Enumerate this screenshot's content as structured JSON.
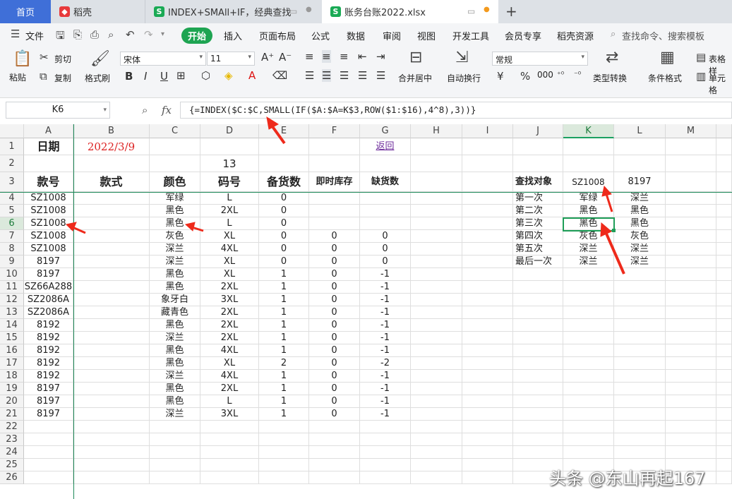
{
  "tabs": {
    "home": "首页",
    "t1": "稻壳",
    "t2": "INDEX+SMAll+IF，经典查找",
    "t3": "账务台账2022.xlsx",
    "new": "+"
  },
  "menubar": {
    "file": "文件",
    "items": [
      "开始",
      "插入",
      "页面布局",
      "公式",
      "数据",
      "审阅",
      "视图",
      "开发工具",
      "会员专享",
      "稻壳资源"
    ],
    "search": "查找命令、搜索模板"
  },
  "toolbar": {
    "paste": "粘贴",
    "cut": "剪切",
    "copy": "复制",
    "format_painter": "格式刷",
    "font_name": "宋体",
    "font_size": "11",
    "merge": "合并居中",
    "wrap": "自动换行",
    "number_format": "常规",
    "type_convert": "类型转换",
    "cond_format": "条件格式",
    "table_style": "表格样",
    "cell_style": "单元格",
    "bold": "B",
    "italic": "I",
    "underline": "U",
    "currency": "¥",
    "percent": "%",
    "thousands": "000"
  },
  "formula_bar": {
    "name_box": "K6",
    "fx": "fx",
    "formula": "{=INDEX($C:$C,SMALL(IF($A:$A=K$3,ROW($1:$16),4^8),3))}"
  },
  "columns": [
    "A",
    "B",
    "C",
    "D",
    "E",
    "F",
    "G",
    "H",
    "I",
    "J",
    "K",
    "L",
    "M"
  ],
  "rows": [
    "1",
    "2",
    "3",
    "4",
    "5",
    "6",
    "7",
    "8",
    "9",
    "10",
    "11",
    "12",
    "13",
    "14",
    "15",
    "16",
    "17",
    "18",
    "19",
    "20",
    "21",
    "22",
    "23",
    "24",
    "25",
    "26"
  ],
  "sheet": {
    "r1": {
      "A": "日期",
      "B": "2022/3/9",
      "G": "返回"
    },
    "r2": {
      "D": "13"
    },
    "r3": {
      "A": "款号",
      "B": "款式",
      "C": "颜色",
      "D": "码号",
      "E": "备货数",
      "F": "即时库存",
      "G": "缺货数",
      "J": "查找对象",
      "K": "SZ1008",
      "L": "8197"
    },
    "data": [
      [
        "SZ1008",
        "",
        "军绿",
        "L",
        "0",
        "",
        "",
        "",
        "",
        "第一次",
        "军绿",
        "深兰"
      ],
      [
        "SZ1008",
        "",
        "黑色",
        "2XL",
        "0",
        "",
        "",
        "",
        "",
        "第二次",
        "黑色",
        "黑色"
      ],
      [
        "SZ1008",
        "",
        "黑色",
        "L",
        "0",
        "",
        "",
        "",
        "",
        "第三次",
        "黑色",
        "黑色"
      ],
      [
        "SZ1008",
        "",
        "灰色",
        "XL",
        "0",
        "0",
        "0",
        "",
        "",
        "第四次",
        "灰色",
        "灰色"
      ],
      [
        "SZ1008",
        "",
        "深兰",
        "4XL",
        "0",
        "0",
        "0",
        "",
        "",
        "第五次",
        "深兰",
        "深兰"
      ],
      [
        "8197",
        "",
        "深兰",
        "XL",
        "0",
        "0",
        "0",
        "",
        "",
        "最后一次",
        "深兰",
        "深兰"
      ],
      [
        "8197",
        "",
        "黑色",
        "XL",
        "1",
        "0",
        "-1",
        "",
        "",
        "",
        "",
        ""
      ],
      [
        "SZ66A288",
        "",
        "黑色",
        "2XL",
        "1",
        "0",
        "-1",
        "",
        "",
        "",
        "",
        ""
      ],
      [
        "SZ2086A",
        "",
        "象牙白",
        "3XL",
        "1",
        "0",
        "-1",
        "",
        "",
        "",
        "",
        ""
      ],
      [
        "SZ2086A",
        "",
        "藏青色",
        "2XL",
        "1",
        "0",
        "-1",
        "",
        "",
        "",
        "",
        ""
      ],
      [
        "8192",
        "",
        "黑色",
        "2XL",
        "1",
        "0",
        "-1",
        "",
        "",
        "",
        "",
        ""
      ],
      [
        "8192",
        "",
        "深兰",
        "2XL",
        "1",
        "0",
        "-1",
        "",
        "",
        "",
        "",
        ""
      ],
      [
        "8192",
        "",
        "黑色",
        "4XL",
        "1",
        "0",
        "-1",
        "",
        "",
        "",
        "",
        ""
      ],
      [
        "8192",
        "",
        "黑色",
        "XL",
        "2",
        "0",
        "-2",
        "",
        "",
        "",
        "",
        ""
      ],
      [
        "8192",
        "",
        "深兰",
        "4XL",
        "1",
        "0",
        "-1",
        "",
        "",
        "",
        "",
        ""
      ],
      [
        "8197",
        "",
        "黑色",
        "2XL",
        "1",
        "0",
        "-1",
        "",
        "",
        "",
        "",
        ""
      ],
      [
        "8197",
        "",
        "黑色",
        "L",
        "1",
        "0",
        "-1",
        "",
        "",
        "",
        "",
        ""
      ],
      [
        "8197",
        "",
        "深兰",
        "3XL",
        "1",
        "0",
        "-1",
        "",
        "",
        "",
        "",
        ""
      ]
    ]
  },
  "colors": {
    "accent": "#1ea452",
    "home_tab": "#3f6fd8",
    "arrow": "#ee2a1b",
    "date_red": "#d22222",
    "link": "#6d2b9b"
  },
  "watermark": "头条 @东山再起167"
}
